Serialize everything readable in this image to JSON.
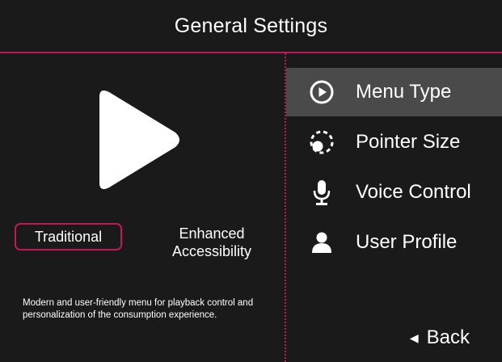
{
  "header": {
    "title": "General Settings"
  },
  "left": {
    "preview_icon": "play-triangle-icon",
    "options": [
      {
        "label": "Traditional",
        "selected": true
      },
      {
        "label_line1": "Enhanced",
        "label_line2": "Accessibility",
        "selected": false
      }
    ],
    "description": "Modern and user-friendly menu for playback control and personalization of the consumption experience."
  },
  "menu": {
    "items": [
      {
        "label": "Menu Type",
        "icon": "play-circle-icon",
        "selected": true
      },
      {
        "label": "Pointer Size",
        "icon": "pointer-size-icon",
        "selected": false
      },
      {
        "label": "Voice Control",
        "icon": "microphone-icon",
        "selected": false
      },
      {
        "label": "User Profile",
        "icon": "user-icon",
        "selected": false
      }
    ],
    "back_label": "Back"
  },
  "colors": {
    "background": "#1a1a1a",
    "accent": "#c2185b",
    "selected_bg": "#4a4a4a",
    "text": "#ffffff"
  }
}
